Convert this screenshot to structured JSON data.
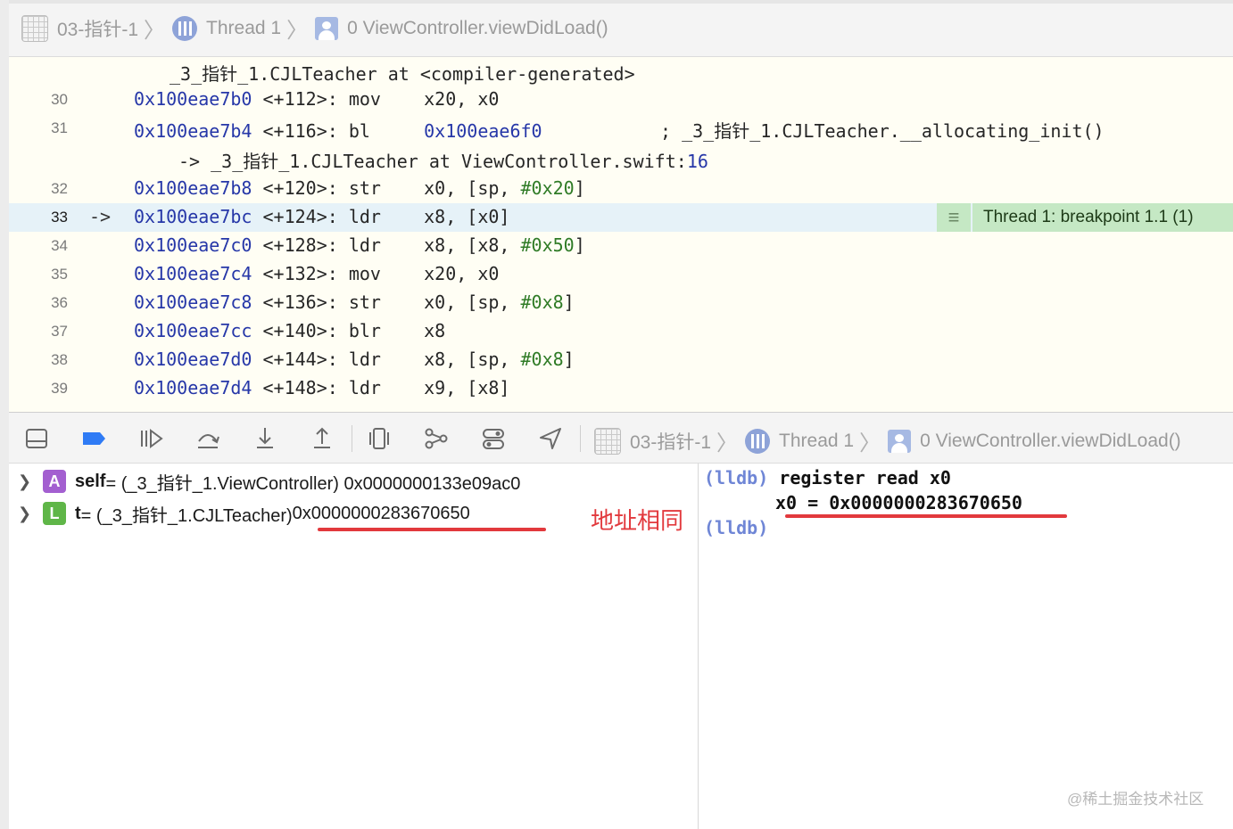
{
  "jumpbar": {
    "target": "03-指针-1",
    "thread": "Thread 1",
    "frame": "0 ViewController.viewDidLoad()"
  },
  "code_lines": [
    {
      "num": "",
      "arrow": "",
      "indent": 180,
      "parts": [
        {
          "t": "_3_指针_1.CJLTeacher at <compiler-generated>",
          "c": "plain"
        }
      ]
    },
    {
      "num": "30",
      "arrow": "",
      "indent": 140,
      "parts": [
        {
          "t": "0x100eae7b0",
          "c": "addr"
        },
        {
          "t": " <+112>: mov    x20, x0",
          "c": "plain"
        }
      ]
    },
    {
      "num": "31",
      "arrow": "",
      "indent": 140,
      "parts": [
        {
          "t": "0x100eae7b4",
          "c": "addr"
        },
        {
          "t": " <+116>: bl     ",
          "c": "plain"
        },
        {
          "t": "0x100eae6f0",
          "c": "addr"
        },
        {
          "t": "           ; _3_指针_1.CJLTeacher.__allocating_init()",
          "c": "plain"
        }
      ]
    },
    {
      "num": "",
      "arrow": "",
      "indent": 190,
      "parts": [
        {
          "t": "-> _3_指针_1.CJLTeacher at ViewController.swift:",
          "c": "plain"
        },
        {
          "t": "16",
          "c": "addr"
        }
      ]
    },
    {
      "num": "32",
      "arrow": "",
      "indent": 140,
      "parts": [
        {
          "t": "0x100eae7b8",
          "c": "addr"
        },
        {
          "t": " <+120>: str    x0, [sp, ",
          "c": "plain"
        },
        {
          "t": "#0x20",
          "c": "num"
        },
        {
          "t": "]",
          "c": "plain"
        }
      ]
    },
    {
      "num": "33",
      "arrow": "->",
      "indent": 140,
      "current": true,
      "parts": [
        {
          "t": "0x100eae7bc",
          "c": "addr"
        },
        {
          "t": " <+124>: ldr    x8, [x0]",
          "c": "plain"
        }
      ]
    },
    {
      "num": "34",
      "arrow": "",
      "indent": 140,
      "parts": [
        {
          "t": "0x100eae7c0",
          "c": "addr"
        },
        {
          "t": " <+128>: ldr    x8, [x8, ",
          "c": "plain"
        },
        {
          "t": "#0x50",
          "c": "num"
        },
        {
          "t": "]",
          "c": "plain"
        }
      ]
    },
    {
      "num": "35",
      "arrow": "",
      "indent": 140,
      "parts": [
        {
          "t": "0x100eae7c4",
          "c": "addr"
        },
        {
          "t": " <+132>: mov    x20, x0",
          "c": "plain"
        }
      ]
    },
    {
      "num": "36",
      "arrow": "",
      "indent": 140,
      "parts": [
        {
          "t": "0x100eae7c8",
          "c": "addr"
        },
        {
          "t": " <+136>: str    x0, [sp, ",
          "c": "plain"
        },
        {
          "t": "#0x8",
          "c": "num"
        },
        {
          "t": "]",
          "c": "plain"
        }
      ]
    },
    {
      "num": "37",
      "arrow": "",
      "indent": 140,
      "parts": [
        {
          "t": "0x100eae7cc",
          "c": "addr"
        },
        {
          "t": " <+140>: blr    x8",
          "c": "plain"
        }
      ]
    },
    {
      "num": "38",
      "arrow": "",
      "indent": 140,
      "parts": [
        {
          "t": "0x100eae7d0",
          "c": "addr"
        },
        {
          "t": " <+144>: ldr    x8, [sp, ",
          "c": "plain"
        },
        {
          "t": "#0x8",
          "c": "num"
        },
        {
          "t": "]",
          "c": "plain"
        }
      ]
    },
    {
      "num": "39",
      "arrow": "",
      "indent": 140,
      "parts": [
        {
          "t": "0x100eae7d4",
          "c": "addr"
        },
        {
          "t": " <+148>: ldr    x9, [x8]",
          "c": "plain"
        }
      ]
    }
  ],
  "breakpoint_label": "Thread 1: breakpoint 1.1 (1)",
  "debug_bar": {
    "target": "03-指针-1",
    "thread": "Thread 1",
    "frame": "0 ViewController.viewDidLoad()",
    "buttons": [
      "hide-debug-area",
      "breakpoints-toggle",
      "continue",
      "step-over",
      "step-into",
      "step-out",
      "debug-view-hierarchy",
      "memory-graph",
      "environment-overrides",
      "simulate-location"
    ]
  },
  "variables": [
    {
      "badge": "A",
      "kind": "arg",
      "name": "self",
      "value": " = (_3_指针_1.ViewController) 0x0000000133e09ac0"
    },
    {
      "badge": "L",
      "kind": "loc",
      "name": "t",
      "value": " = (_3_指针_1.CJLTeacher) ",
      "addr": "0x0000000283670650"
    }
  ],
  "annotation_note": "地址相同",
  "console": {
    "prompt": "(lldb)",
    "command": "register read x0",
    "output": "x0 = 0x0000000283670650"
  },
  "watermark": "@稀土掘金技术社区",
  "colors": {
    "address": "#2637a8",
    "number": "#2f7b26",
    "highlight": "#e6f2f8",
    "breakpoint": "#c5e8c4",
    "annotation_red": "#e2393d",
    "prompt": "#6f86d6"
  }
}
